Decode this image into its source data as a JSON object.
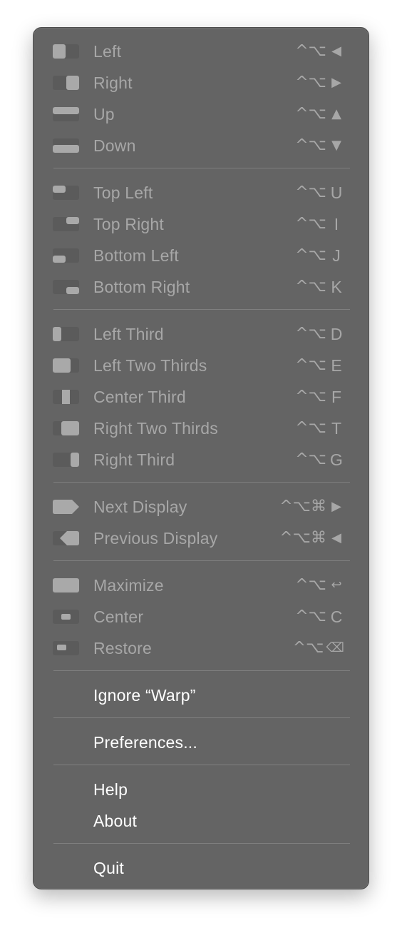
{
  "menu": {
    "sections": [
      {
        "items": [
          {
            "label": "Left",
            "icon": "left-half-icon",
            "shortcut": {
              "mods": "^⌥",
              "key": "◀"
            }
          },
          {
            "label": "Right",
            "icon": "right-half-icon",
            "shortcut": {
              "mods": "^⌥",
              "key": "▶"
            }
          },
          {
            "label": "Up",
            "icon": "top-half-icon",
            "shortcut": {
              "mods": "^⌥",
              "key": "▲"
            }
          },
          {
            "label": "Down",
            "icon": "bottom-half-icon",
            "shortcut": {
              "mods": "^⌥",
              "key": "▼"
            }
          }
        ]
      },
      {
        "items": [
          {
            "label": "Top Left",
            "icon": "top-left-quarter-icon",
            "shortcut": {
              "mods": "^⌥",
              "key": "U"
            }
          },
          {
            "label": "Top Right",
            "icon": "top-right-quarter-icon",
            "shortcut": {
              "mods": "^⌥",
              "key": "I"
            }
          },
          {
            "label": "Bottom Left",
            "icon": "bottom-left-quarter-icon",
            "shortcut": {
              "mods": "^⌥",
              "key": "J"
            }
          },
          {
            "label": "Bottom Right",
            "icon": "bottom-right-quarter-icon",
            "shortcut": {
              "mods": "^⌥",
              "key": "K"
            }
          }
        ]
      },
      {
        "items": [
          {
            "label": "Left Third",
            "icon": "left-third-icon",
            "shortcut": {
              "mods": "^⌥",
              "key": "D"
            }
          },
          {
            "label": "Left Two Thirds",
            "icon": "left-two-thirds-icon",
            "shortcut": {
              "mods": "^⌥",
              "key": "E"
            }
          },
          {
            "label": "Center Third",
            "icon": "center-third-icon",
            "shortcut": {
              "mods": "^⌥",
              "key": "F"
            }
          },
          {
            "label": "Right Two Thirds",
            "icon": "right-two-thirds-icon",
            "shortcut": {
              "mods": "^⌥",
              "key": "T"
            }
          },
          {
            "label": "Right Third",
            "icon": "right-third-icon",
            "shortcut": {
              "mods": "^⌥",
              "key": "G"
            }
          }
        ]
      },
      {
        "items": [
          {
            "label": "Next Display",
            "icon": "next-display-icon",
            "shortcut": {
              "mods": "^⌥⌘",
              "key": "▶"
            }
          },
          {
            "label": "Previous Display",
            "icon": "previous-display-icon",
            "shortcut": {
              "mods": "^⌥⌘",
              "key": "◀"
            }
          }
        ]
      },
      {
        "items": [
          {
            "label": "Maximize",
            "icon": "maximize-icon",
            "shortcut": {
              "mods": "^⌥",
              "key": "↩"
            }
          },
          {
            "label": "Center",
            "icon": "center-icon",
            "shortcut": {
              "mods": "^⌥",
              "key": "C"
            }
          },
          {
            "label": "Restore",
            "icon": "restore-icon",
            "shortcut": {
              "mods": "^⌥",
              "key": "⌫"
            }
          }
        ]
      },
      {
        "items": [
          {
            "label": "Ignore “Warp”"
          }
        ]
      },
      {
        "items": [
          {
            "label": "Preferences..."
          }
        ]
      },
      {
        "items": [
          {
            "label": "Help"
          },
          {
            "label": "About"
          }
        ]
      },
      {
        "items": [
          {
            "label": "Quit"
          }
        ]
      }
    ]
  },
  "colors": {
    "menu_background": "#646464",
    "disabled_text": "#a7a7a7",
    "enabled_text": "#ffffff",
    "separator": "#7f7f7f",
    "icon_frame": "#5b5b5b",
    "icon_fill": "#a9a9a9"
  }
}
